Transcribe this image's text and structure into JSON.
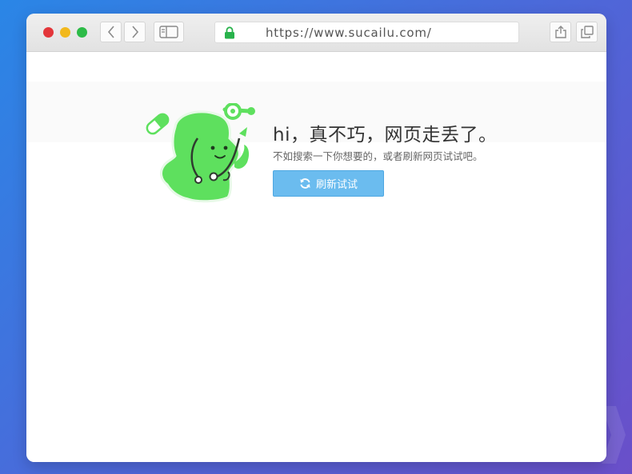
{
  "browser": {
    "url": "https://www.sucailu.com/",
    "icons": {
      "back": "chevron-left-icon",
      "forward": "chevron-right-icon",
      "sidebar": "sidebar-icon",
      "lock": "lock-icon",
      "share": "share-icon",
      "tabs": "tabs-icon"
    }
  },
  "error_page": {
    "headline": "hi，真不巧，网页走丢了。",
    "subline": "不如搜索一下你想要的，或者刷新网页试试吧。",
    "refresh_label": "刷新试试",
    "refresh_icon": "refresh-icon",
    "mascot": "green-doctor-mascot-illustration"
  },
  "colors": {
    "background_start": "#2a86e6",
    "background_end": "#6a4fc9",
    "mascot_green": "#5ee05e",
    "button_blue": "#6bbcef",
    "lock_green": "#28b24b"
  }
}
